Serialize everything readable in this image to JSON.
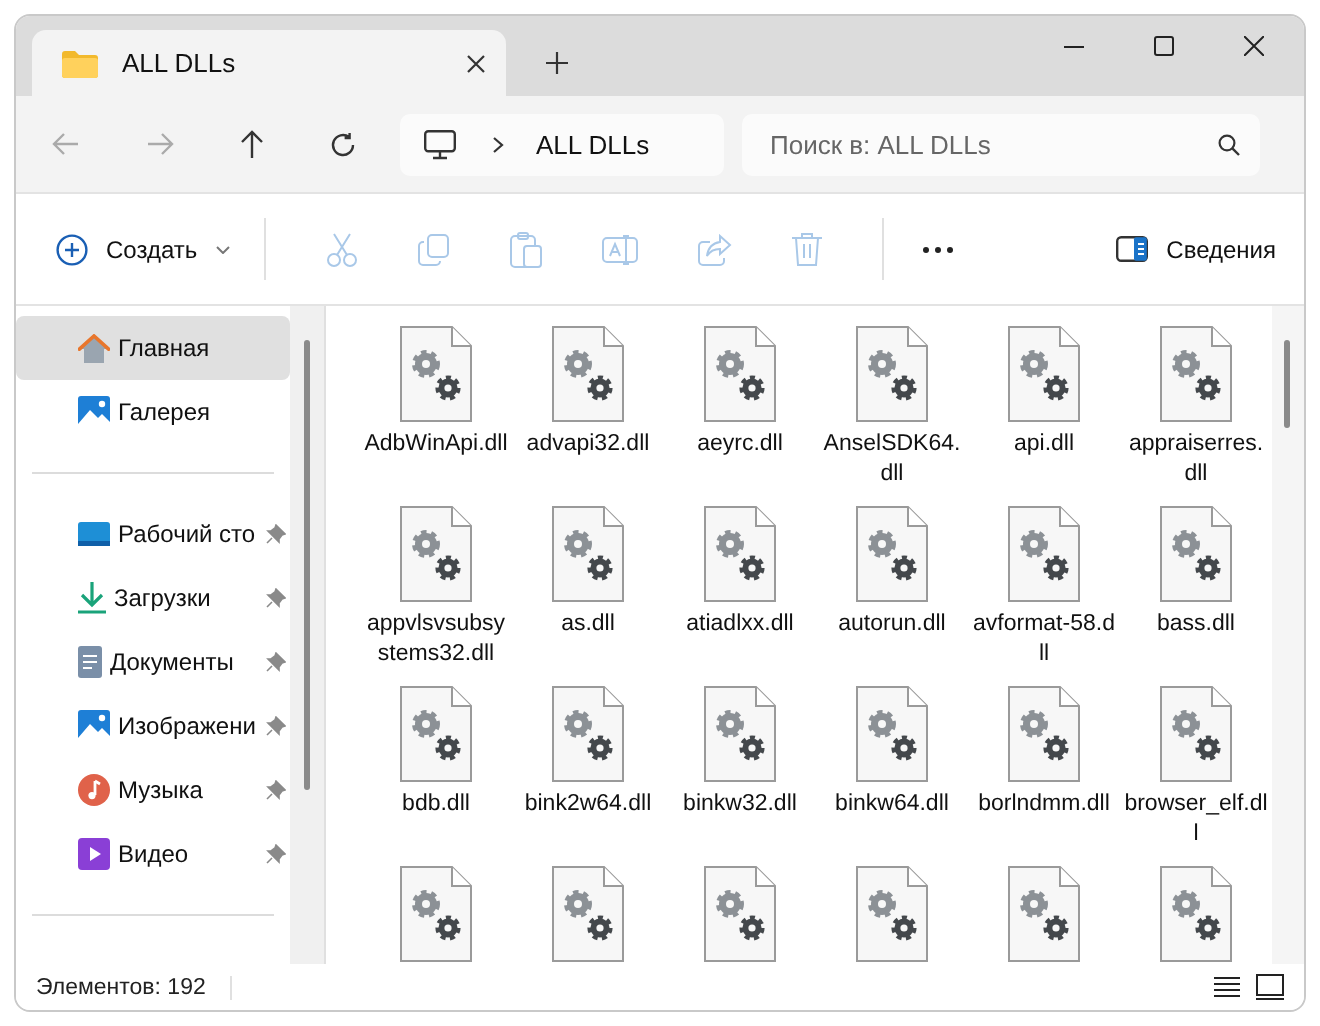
{
  "window": {
    "tab_title": "ALL DLLs"
  },
  "address": {
    "path": "ALL DLLs"
  },
  "search": {
    "placeholder": "Поиск в: ALL DLLs"
  },
  "toolbar": {
    "create_label": "Создать",
    "actions": [
      {
        "kind": "cut",
        "disabled": true
      },
      {
        "kind": "copy",
        "disabled": true
      },
      {
        "kind": "paste",
        "disabled": true
      },
      {
        "kind": "rename",
        "disabled": true
      },
      {
        "kind": "share",
        "disabled": true
      },
      {
        "kind": "delete",
        "disabled": true
      }
    ],
    "details_label": "Сведения"
  },
  "sidebar": {
    "items": [
      {
        "kind": "home",
        "label": "Главная",
        "selected": true,
        "pinned": false
      },
      {
        "kind": "gallery",
        "label": "Галерея",
        "selected": false,
        "pinned": false
      },
      {
        "kind": "divider"
      },
      {
        "kind": "desktop",
        "label": "Рабочий сто",
        "selected": false,
        "pinned": true
      },
      {
        "kind": "downloads",
        "label": "Загрузки",
        "selected": false,
        "pinned": true
      },
      {
        "kind": "documents",
        "label": "Документы",
        "selected": false,
        "pinned": true
      },
      {
        "kind": "pictures",
        "label": "Изображени",
        "selected": false,
        "pinned": true
      },
      {
        "kind": "music",
        "label": "Музыка",
        "selected": false,
        "pinned": true
      },
      {
        "kind": "videos",
        "label": "Видео",
        "selected": false,
        "pinned": true
      }
    ]
  },
  "files": [
    {
      "name": "AdbWinApi.dll"
    },
    {
      "name": "advapi32.dll"
    },
    {
      "name": "aeyrc.dll"
    },
    {
      "name": "AnselSDK64.dll"
    },
    {
      "name": "api.dll"
    },
    {
      "name": "appraiserres.dll"
    },
    {
      "name": "appvlsvsubsystems32.dll"
    },
    {
      "name": "as.dll"
    },
    {
      "name": "atiadlxx.dll"
    },
    {
      "name": "autorun.dll"
    },
    {
      "name": "avformat-58.dll"
    },
    {
      "name": "bass.dll"
    },
    {
      "name": "bdb.dll"
    },
    {
      "name": "bink2w64.dll"
    },
    {
      "name": "binkw32.dll"
    },
    {
      "name": "binkw64.dll"
    },
    {
      "name": "borlndmm.dll"
    },
    {
      "name": "browser_elf.dll"
    }
  ],
  "status_bar": {
    "item_count": "Элементов: 192"
  }
}
